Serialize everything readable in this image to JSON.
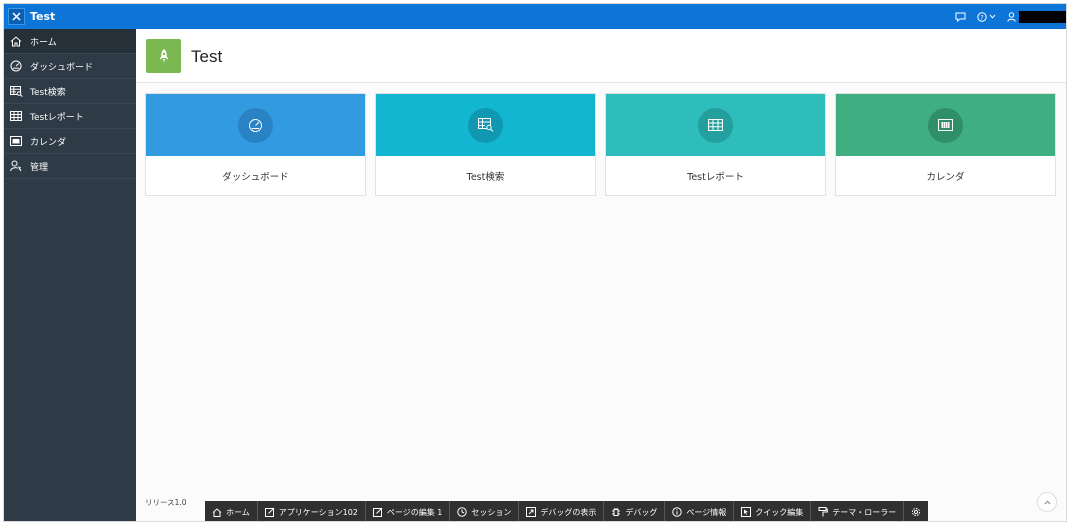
{
  "header": {
    "app_title": "Test",
    "icons": [
      "feedback-icon",
      "help-icon",
      "user-icon"
    ]
  },
  "sidebar": {
    "items": [
      {
        "label": "ホーム",
        "icon": "home-icon",
        "active": true
      },
      {
        "label": "ダッシュボード",
        "icon": "dashboard-icon"
      },
      {
        "label": "Test検索",
        "icon": "search-grid-icon"
      },
      {
        "label": "Testレポート",
        "icon": "report-icon"
      },
      {
        "label": "カレンダ",
        "icon": "calendar-icon"
      },
      {
        "label": "管理",
        "icon": "admin-icon"
      }
    ]
  },
  "page": {
    "title": "Test",
    "hero_icon": "rocket-icon",
    "hero_color": "#7bb852"
  },
  "cards": [
    {
      "label": "ダッシュボード",
      "color": "#329adf",
      "icon_bg": "#2982c4",
      "icon": "dashboard-icon"
    },
    {
      "label": "Test検索",
      "color": "#13b6d1",
      "icon_bg": "#0f98b0",
      "icon": "search-grid-icon"
    },
    {
      "label": "Testレポート",
      "color": "#2fbdbb",
      "icon_bg": "#23a09e",
      "icon": "table-icon"
    },
    {
      "label": "カレンダ",
      "color": "#3fae80",
      "icon_bg": "#2f8f66",
      "icon": "calendar-icon"
    }
  ],
  "footer": {
    "release": "リリース1.0"
  },
  "devbar": {
    "items": [
      {
        "label": "ホーム",
        "icon": "home-icon"
      },
      {
        "label": "アプリケーション102",
        "icon": "edit-icon"
      },
      {
        "label": "ページの編集 1",
        "icon": "edit-page-icon"
      },
      {
        "label": "セッション",
        "icon": "session-icon"
      },
      {
        "label": "デバッグの表示",
        "icon": "view-debug-icon"
      },
      {
        "label": "デバッグ",
        "icon": "bug-icon"
      },
      {
        "label": "ページ情報",
        "icon": "info-icon"
      },
      {
        "label": "クイック編集",
        "icon": "quick-edit-icon"
      },
      {
        "label": "テーマ・ローラー",
        "icon": "paint-roller-icon"
      },
      {
        "label": "",
        "icon": "settings-icon"
      }
    ]
  }
}
